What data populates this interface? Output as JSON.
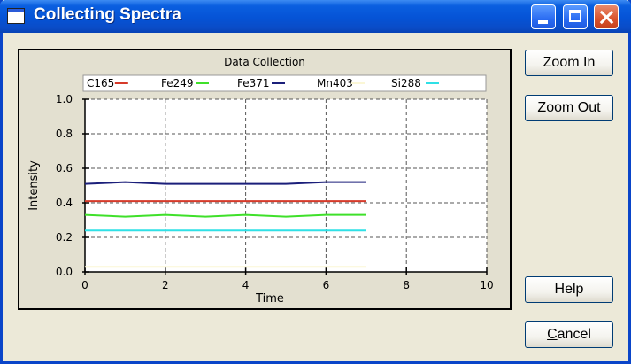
{
  "window": {
    "title": "Collecting Spectra"
  },
  "buttons": {
    "zoom_in": "Zoom In",
    "zoom_out": "Zoom Out",
    "help": "Help",
    "cancel_prefix": "C",
    "cancel_rest": "ancel"
  },
  "chart_data": {
    "type": "line",
    "title": "Data Collection",
    "xlabel": "Time",
    "ylabel": "Intensity",
    "xlim": [
      0,
      10
    ],
    "ylim": [
      0.0,
      1.0
    ],
    "xticks": [
      "0",
      "2",
      "4",
      "6",
      "8",
      "10"
    ],
    "yticks": [
      "0.0",
      "0.2",
      "0.4",
      "0.6",
      "0.8",
      "1.0"
    ],
    "grid": true,
    "legend_position": "top",
    "series": [
      {
        "name": "C165",
        "color": "#d63a2a",
        "x": [
          0,
          1,
          2,
          3,
          4,
          5,
          6,
          7
        ],
        "values": [
          0.41,
          0.41,
          0.41,
          0.41,
          0.41,
          0.41,
          0.41,
          0.41
        ]
      },
      {
        "name": "Fe249",
        "color": "#3fe02a",
        "x": [
          0,
          1,
          2,
          3,
          4,
          5,
          6,
          7
        ],
        "values": [
          0.33,
          0.32,
          0.33,
          0.32,
          0.33,
          0.32,
          0.33,
          0.33
        ]
      },
      {
        "name": "Fe371",
        "color": "#1b1f7a",
        "x": [
          0,
          1,
          2,
          3,
          4,
          5,
          6,
          7
        ],
        "values": [
          0.51,
          0.52,
          0.51,
          0.51,
          0.51,
          0.51,
          0.52,
          0.52
        ]
      },
      {
        "name": "Mn403",
        "color": "#fbf7d6",
        "x": [
          0,
          1,
          2,
          3,
          4,
          5,
          6,
          7
        ],
        "values": [
          0.03,
          0.03,
          0.03,
          0.03,
          0.03,
          0.03,
          0.03,
          0.03
        ]
      },
      {
        "name": "Si288",
        "color": "#2fe0e6",
        "x": [
          0,
          1,
          2,
          3,
          4,
          5,
          6,
          7
        ],
        "values": [
          0.24,
          0.24,
          0.24,
          0.24,
          0.24,
          0.24,
          0.24,
          0.24
        ]
      }
    ]
  }
}
